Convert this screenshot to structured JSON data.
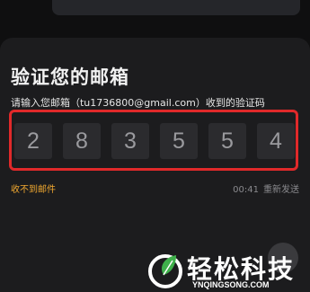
{
  "page": {
    "title": "验证您的邮箱",
    "subtitle": "请输入您邮箱（tu1736800@gmail.com）收到的验证码"
  },
  "code": {
    "digits": [
      "2",
      "8",
      "3",
      "5",
      "5",
      "4"
    ]
  },
  "footer": {
    "not_received_label": "收不到邮件",
    "countdown": "00:41",
    "resend_label": "重新发送"
  },
  "watermark": {
    "text": "轻松科技",
    "sub": "YNQINGSONG.COM"
  },
  "colors": {
    "accent": "#f0a830",
    "highlight": "#e0292a",
    "background": "#1c1c1e"
  }
}
